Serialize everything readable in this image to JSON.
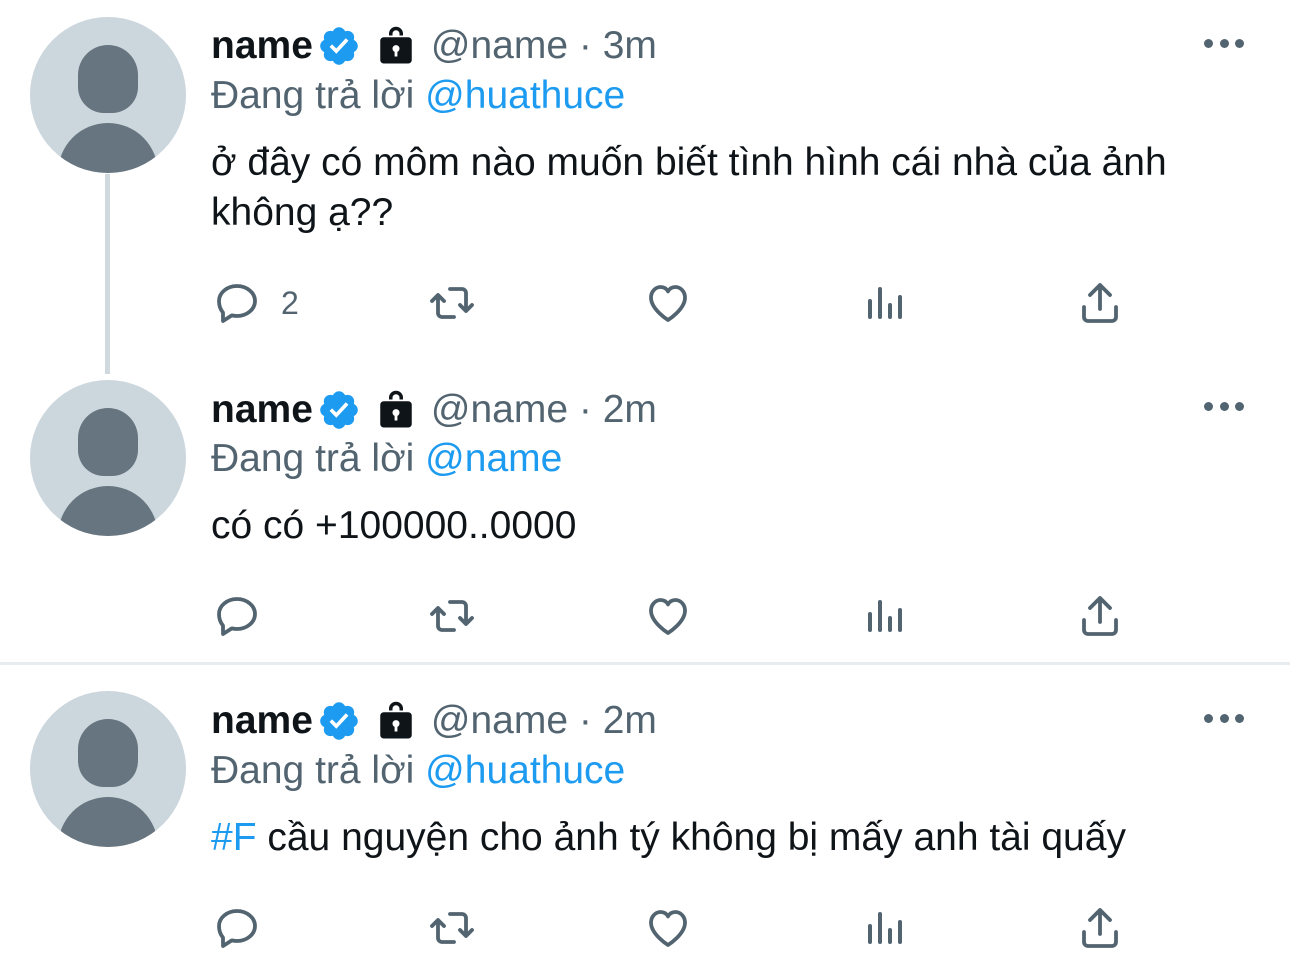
{
  "tweets": [
    {
      "name": "name",
      "handle_time": "@name · 3m",
      "reply_prefix": "Đang trả lời",
      "reply_to": "@huathuce",
      "text": "ở đây có môm nào muốn biết tình hình cái nhà của ảnh không ạ??",
      "reply_count": "2"
    },
    {
      "name": "name",
      "handle_time": "@name · 2m",
      "reply_prefix": "Đang trả lời",
      "reply_to": "@name",
      "text": "có có +100000..0000",
      "reply_count": ""
    },
    {
      "name": "name",
      "handle_time": "@name · 2m",
      "reply_prefix": "Đang trả lời",
      "reply_to": "@huathuce",
      "hashtag": "#F",
      "text": " cầu nguyện cho ảnh tý không bị mấy anh tài quấy",
      "reply_count": ""
    }
  ],
  "colors": {
    "accent": "#1d9bf0",
    "secondary_text": "#536471",
    "avatar_bg": "#ccd6dd",
    "avatar_fg": "#66757f"
  },
  "icons": [
    "verified-badge-icon",
    "lock-icon",
    "more-icon",
    "reply-icon",
    "retweet-icon",
    "like-icon",
    "analytics-icon",
    "share-icon"
  ]
}
